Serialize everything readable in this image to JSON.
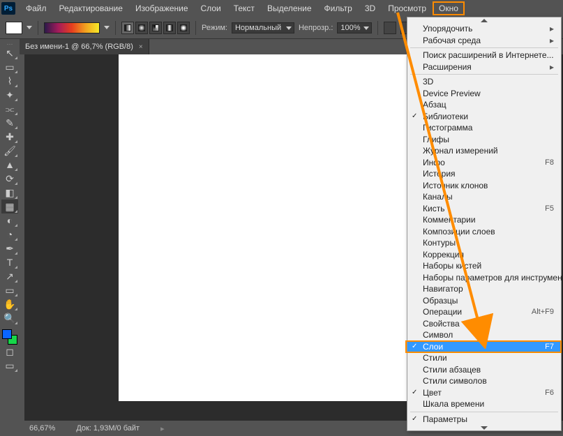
{
  "logo_text": "Ps",
  "menubar": {
    "items": [
      "Файл",
      "Редактирование",
      "Изображение",
      "Слои",
      "Текст",
      "Выделение",
      "Фильтр",
      "3D",
      "Просмотр",
      "Окно"
    ],
    "highlighted_index": 9
  },
  "options_bar": {
    "mode_label": "Режим:",
    "mode_value": "Нормальный",
    "opacity_label": "Непрозр.:",
    "opacity_value": "100%"
  },
  "document_tab": {
    "title": "Без имени-1 @ 66,7% (RGB/8)",
    "close": "×"
  },
  "status": {
    "zoom": "66,67%",
    "doc_info": "Док: 1,93M/0 байт"
  },
  "dropdown": {
    "sections": [
      [
        {
          "label": "Упорядочить",
          "sub": true
        },
        {
          "label": "Рабочая среда",
          "sub": true
        }
      ],
      [
        {
          "label": "Поиск расширений в Интернете..."
        },
        {
          "label": "Расширения",
          "sub": true
        }
      ],
      [
        {
          "label": "3D"
        },
        {
          "label": "Device Preview"
        },
        {
          "label": "Абзац"
        },
        {
          "label": "Библиотеки",
          "checked": true
        },
        {
          "label": "Гистограмма"
        },
        {
          "label": "Глифы"
        },
        {
          "label": "Журнал измерений"
        },
        {
          "label": "Инфо",
          "shortcut": "F8"
        },
        {
          "label": "История"
        },
        {
          "label": "Источник клонов"
        },
        {
          "label": "Каналы"
        },
        {
          "label": "Кисть",
          "shortcut": "F5"
        },
        {
          "label": "Комментарии"
        },
        {
          "label": "Композиции слоев"
        },
        {
          "label": "Контуры"
        },
        {
          "label": "Коррекция"
        },
        {
          "label": "Наборы кистей"
        },
        {
          "label": "Наборы параметров для инструментов"
        },
        {
          "label": "Навигатор"
        },
        {
          "label": "Образцы"
        },
        {
          "label": "Операции",
          "shortcut": "Alt+F9"
        },
        {
          "label": "Свойства"
        },
        {
          "label": "Символ"
        },
        {
          "label": "Слои",
          "shortcut": "F7",
          "checked": true,
          "selected": true
        },
        {
          "label": "Стили"
        },
        {
          "label": "Стили абзацев"
        },
        {
          "label": "Стили символов"
        },
        {
          "label": "Цвет",
          "shortcut": "F6",
          "checked": true
        },
        {
          "label": "Шкала времени"
        }
      ],
      [
        {
          "label": "Параметры",
          "checked": true
        }
      ]
    ]
  },
  "tools": [
    {
      "name": "move-tool",
      "glyph": "↖"
    },
    {
      "name": "marquee-tool",
      "glyph": "▭"
    },
    {
      "name": "lasso-tool",
      "glyph": "⌇"
    },
    {
      "name": "magic-wand-tool",
      "glyph": "✦"
    },
    {
      "name": "crop-tool",
      "glyph": "⫗"
    },
    {
      "name": "eyedropper-tool",
      "glyph": "✎"
    },
    {
      "name": "healing-tool",
      "glyph": "✚"
    },
    {
      "name": "brush-tool",
      "glyph": "🖌"
    },
    {
      "name": "stamp-tool",
      "glyph": "▲"
    },
    {
      "name": "history-brush-tool",
      "glyph": "⟳"
    },
    {
      "name": "eraser-tool",
      "glyph": "◧"
    },
    {
      "name": "gradient-tool",
      "glyph": "▦",
      "active": true
    },
    {
      "name": "blur-tool",
      "glyph": "◐"
    },
    {
      "name": "dodge-tool",
      "glyph": "◔"
    },
    {
      "name": "pen-tool",
      "glyph": "✒"
    },
    {
      "name": "type-tool",
      "glyph": "T"
    },
    {
      "name": "path-select-tool",
      "glyph": "↗"
    },
    {
      "name": "shape-tool",
      "glyph": "▭"
    },
    {
      "name": "hand-tool",
      "glyph": "✋"
    },
    {
      "name": "zoom-tool",
      "glyph": "🔍"
    }
  ]
}
